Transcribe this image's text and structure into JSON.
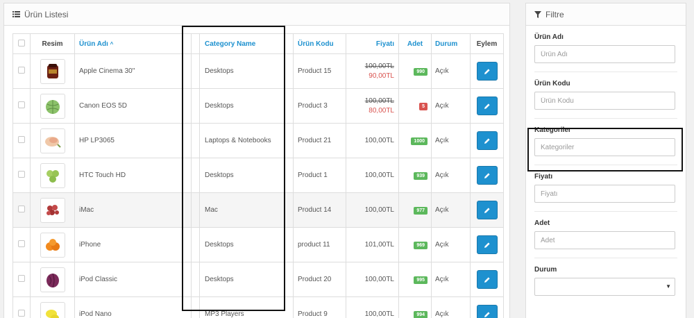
{
  "list_panel": {
    "title": "Ürün Listesi",
    "icon": "list-icon",
    "columns": {
      "image": "Resim",
      "name": "Ürün Adı",
      "sort_indicator": "^",
      "category": "Category Name",
      "code": "Ürün Kodu",
      "price": "Fiyatı",
      "quantity": "Adet",
      "status": "Durum",
      "action": "Eylem"
    },
    "rows": [
      {
        "name": "Apple Cinema 30\"",
        "category": "Desktops",
        "code": "Product 15",
        "old_price": "100,00TL",
        "price": "90,00TL",
        "qty": "990",
        "qty_color": "#5cb85c",
        "status": "Açık",
        "thumb": "cinema"
      },
      {
        "name": "Canon EOS 5D",
        "category": "Desktops",
        "code": "Product 3",
        "old_price": "100,00TL",
        "price": "80,00TL",
        "qty": "5",
        "qty_color": "#d9534f",
        "status": "Açık",
        "thumb": "cabbage"
      },
      {
        "name": "HP LP3065",
        "category": "Laptops & Notebooks",
        "code": "Product 21",
        "old_price": "",
        "price": "100,00TL",
        "qty": "1000",
        "qty_color": "#5cb85c",
        "status": "Açık",
        "thumb": "chicken"
      },
      {
        "name": "HTC Touch HD",
        "category": "Desktops",
        "code": "Product 1",
        "old_price": "",
        "price": "100,00TL",
        "qty": "939",
        "qty_color": "#5cb85c",
        "status": "Açık",
        "thumb": "grapes"
      },
      {
        "name": "iMac",
        "category": "Mac",
        "code": "Product 14",
        "old_price": "",
        "price": "100,00TL",
        "qty": "977",
        "qty_color": "#5cb85c",
        "status": "Açık",
        "thumb": "meat"
      },
      {
        "name": "iPhone",
        "category": "Desktops",
        "code": "product 11",
        "old_price": "",
        "price": "101,00TL",
        "qty": "969",
        "qty_color": "#5cb85c",
        "status": "Açık",
        "thumb": "orange"
      },
      {
        "name": "iPod Classic",
        "category": "Desktops",
        "code": "Product 20",
        "old_price": "",
        "price": "100,00TL",
        "qty": "995",
        "qty_color": "#5cb85c",
        "status": "Açık",
        "thumb": "redcabbage"
      },
      {
        "name": "iPod Nano",
        "category": "MP3 Players",
        "code": "Product 9",
        "old_price": "",
        "price": "100,00TL",
        "qty": "994",
        "qty_color": "#5cb85c",
        "status": "Açık",
        "thumb": "lemon"
      }
    ]
  },
  "filter_panel": {
    "title": "Filtre",
    "icon": "filter-icon",
    "fields": {
      "name": {
        "label": "Ürün Adı",
        "placeholder": "Ürün Adı"
      },
      "code": {
        "label": "Ürün Kodu",
        "placeholder": "Ürün Kodu"
      },
      "category": {
        "label": "Kategoriler",
        "placeholder": "Kategoriler"
      },
      "price": {
        "label": "Fiyatı",
        "placeholder": "Fiyatı"
      },
      "quantity": {
        "label": "Adet",
        "placeholder": "Adet"
      },
      "status": {
        "label": "Durum",
        "value": ""
      }
    }
  },
  "colors": {
    "accent": "#1e91cf",
    "badge_green": "#5cb85c",
    "badge_red": "#d9534f",
    "sale_price": "#d9534f"
  }
}
